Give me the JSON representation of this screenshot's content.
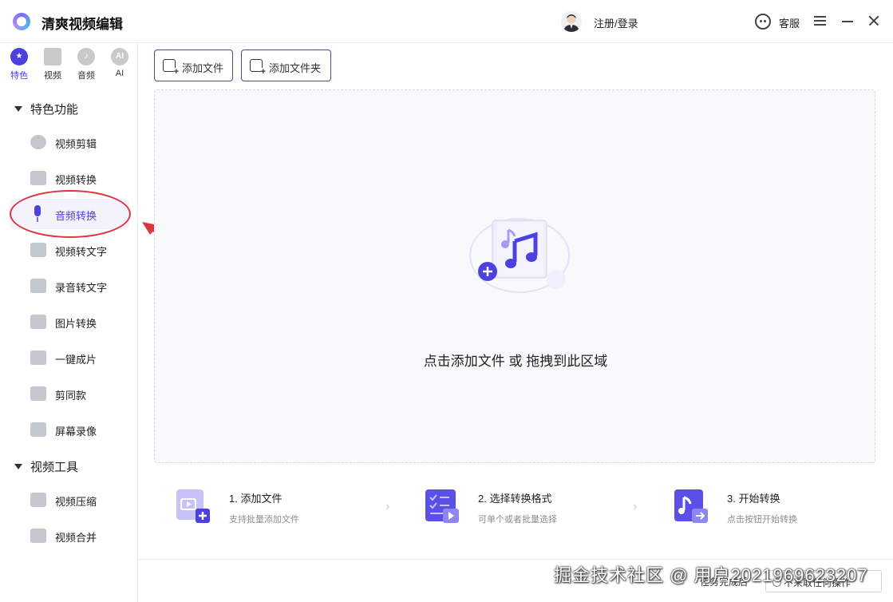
{
  "app": {
    "title": "清爽视频编辑"
  },
  "header": {
    "login_label": "注册/登录",
    "service_label": "客服"
  },
  "categories": [
    {
      "label": "特色",
      "icon": "star-icon",
      "glyph": "★"
    },
    {
      "label": "视频",
      "icon": "film-icon",
      "glyph": ""
    },
    {
      "label": "音频",
      "icon": "audio-icon",
      "glyph": "♪"
    },
    {
      "label": "AI",
      "icon": "ai-icon",
      "glyph": "AI"
    }
  ],
  "sidebar": {
    "group1_title": "特色功能",
    "group1_items": [
      {
        "label": "视频剪辑"
      },
      {
        "label": "视频转换"
      },
      {
        "label": "音频转换"
      },
      {
        "label": "视频转文字"
      },
      {
        "label": "录音转文字"
      },
      {
        "label": "图片转换"
      },
      {
        "label": "一键成片"
      },
      {
        "label": "剪同款"
      },
      {
        "label": "屏幕录像"
      }
    ],
    "group2_title": "视频工具",
    "group2_items": [
      {
        "label": "视频压缩"
      },
      {
        "label": "视频合并"
      }
    ],
    "active_item": "音频转换"
  },
  "toolbar": {
    "add_file_label": "添加文件",
    "add_folder_label": "添加文件夹"
  },
  "dropzone": {
    "text": "点击添加文件 或 拖拽到此区域"
  },
  "steps": [
    {
      "title": "1. 添加文件",
      "desc": "支持批量添加文件"
    },
    {
      "title": "2. 选择转换格式",
      "desc": "可单个或者批量选择"
    },
    {
      "title": "3. 开始转换",
      "desc": "点击按钮开始转换"
    }
  ],
  "footer": {
    "after_done_label": "任务完成后",
    "after_done_value": "不来取任何操作"
  },
  "watermark": "掘金技术社区 @ 用户2021969623207",
  "colors": {
    "accent": "#4c41e0",
    "annotation": "#d9363e"
  }
}
